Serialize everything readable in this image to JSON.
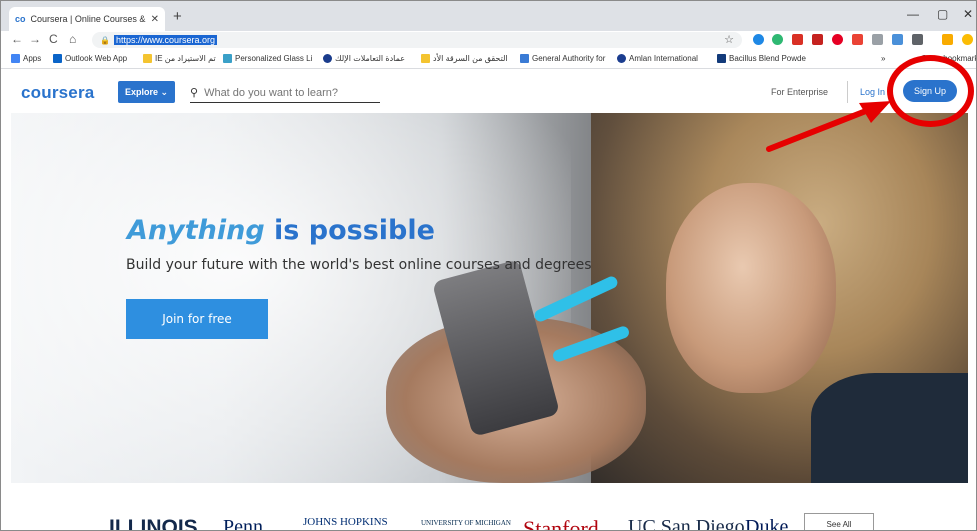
{
  "browser": {
    "tab_title": "Coursera | Online Courses & Cre",
    "tab_icon": "co",
    "new_tab": "+",
    "url": "https://www.coursera.org",
    "window_controls": {
      "minimize": "—",
      "maximize": "▢",
      "close": "✕"
    },
    "nav": {
      "back": "←",
      "forward": "→",
      "reload": "C",
      "home": "⌂"
    }
  },
  "bookmarks": [
    {
      "label": "Apps",
      "color": "#4285f4"
    },
    {
      "label": "Outlook Web App",
      "color": "#0a64c8"
    },
    {
      "label": "IE تم الاستيراد من",
      "color": "#f4c430"
    },
    {
      "label": "Personalized Glass Li",
      "color": "#3aa0c8"
    },
    {
      "label": "عمادة التعاملات الإلك",
      "color": "#1a3c8c"
    },
    {
      "label": "التحقق من السرقة الأد",
      "color": "#f4c430"
    },
    {
      "label": "General Authority for",
      "color": "#3a7bd5"
    },
    {
      "label": "Amlan International",
      "color": "#1b3d8f"
    },
    {
      "label": "Bacillus Blend Powde",
      "color": "#123a7a"
    }
  ],
  "bookmarks_overflow": "»",
  "bookmarks_other": "Other bookmarks",
  "site": {
    "logo": "coursera",
    "explore": "Explore ⌄",
    "search_placeholder": "What do you want to learn?",
    "for_enterprise": "For Enterprise",
    "login": "Log In",
    "signup": "Sign Up"
  },
  "hero": {
    "headline_em": "Anything",
    "headline_rest": " is possible",
    "subline": "Build your future with the world's best online courses and degrees",
    "cta": "Join for free"
  },
  "partners": [
    "ILLINOIS",
    "Penn",
    "JOHNS HOPKINS",
    "UNIVERSITY OF MICHIGAN",
    "Stanford",
    "UC San Diego",
    "Duke"
  ],
  "see_all": "See All",
  "colors": {
    "brand": "#2a73cc",
    "annotation": "#e60000"
  }
}
